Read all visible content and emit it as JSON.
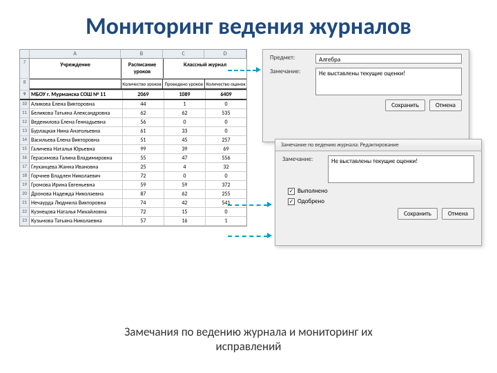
{
  "title": "Мониторинг ведения журналов",
  "caption": "Замечания по ведению журнала и мониторинг их исправлений",
  "sheet": {
    "cols": [
      "A",
      "B",
      "C",
      "D"
    ],
    "header1": {
      "a": "Учреждение",
      "b": "Расписание уроков",
      "cd": "Классный журнал"
    },
    "header2": {
      "b": "Количество уроков",
      "c": "Проведено уроков",
      "d": "Количество оценок"
    },
    "summary": {
      "a": "МБОУ г. Мурманска СОШ № 11",
      "b": "2069",
      "c": "1089",
      "d": "6409"
    },
    "rows": [
      {
        "n": "10",
        "a": "Аликова Елена Викторовна",
        "b": "44",
        "c": "1",
        "d": "0"
      },
      {
        "n": "11",
        "a": "Беликова Татьяна Александровна",
        "b": "62",
        "c": "62",
        "d": "535"
      },
      {
        "n": "12",
        "a": "Веденилова Елена Геннадьевна",
        "b": "56",
        "c": "0",
        "d": "0"
      },
      {
        "n": "13",
        "a": "Бурлацкая Нина Анатольевна",
        "b": "61",
        "c": "33",
        "d": "0"
      },
      {
        "n": "14",
        "a": "Васильева Елена Викторовна",
        "b": "51",
        "c": "45",
        "d": "257"
      },
      {
        "n": "15",
        "a": "Галичева Наталья Юрьевна",
        "b": "99",
        "c": "39",
        "d": "69"
      },
      {
        "n": "16",
        "a": "Герасимова Галина Владимировна",
        "b": "55",
        "c": "47",
        "d": "556"
      },
      {
        "n": "17",
        "a": "Глуханцева Жанна Ивановна",
        "b": "25",
        "c": "4",
        "d": "32"
      },
      {
        "n": "18",
        "a": "Горчнев Владлен Николаевич",
        "b": "72",
        "c": "0",
        "d": "0"
      },
      {
        "n": "19",
        "a": "Громова Ирина Евгеньевна",
        "b": "59",
        "c": "59",
        "d": "372"
      },
      {
        "n": "20",
        "a": "Дронова Надежда Николаевна",
        "b": "87",
        "c": "62",
        "d": "255"
      },
      {
        "n": "21",
        "a": "Нечаурда Людмила Викторовна",
        "b": "74",
        "c": "42",
        "d": "541"
      },
      {
        "n": "22",
        "a": "Кузнецова Наталья Михайловна",
        "b": "72",
        "c": "15",
        "d": "0"
      },
      {
        "n": "23",
        "a": "Кузьмова Татьяна Николаевна",
        "b": "57",
        "c": "16",
        "d": "1"
      }
    ],
    "rownums_main": [
      "7",
      "8",
      "9"
    ]
  },
  "panel1": {
    "subject_label": "Предмет:",
    "subject_value": "Алгебра",
    "remark_label": "Замечание:",
    "remark_value": "Не выставлены текущие оценки!",
    "save": "Сохранить",
    "cancel": "Отмена"
  },
  "panel2": {
    "title": "Замечание по ведению журнала: Редактирование",
    "remark_label": "Замечание:",
    "remark_value": "Не выставлены текущие оценки!",
    "chk1": "Выполнено",
    "chk2": "Одобрено",
    "save": "Сохранить",
    "cancel": "Отмена"
  }
}
